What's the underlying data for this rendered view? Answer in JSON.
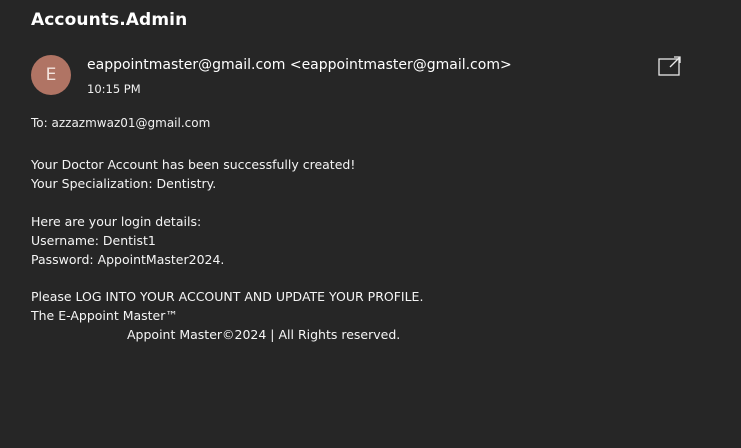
{
  "email": {
    "subject": "Accounts.Admin",
    "avatar_initial": "E",
    "sender": "eappointmaster@gmail.com <eappointmaster@gmail.com>",
    "time": "10:15 PM",
    "to": "To: azzazmwaz01@gmail.com",
    "popout_icon": "open-in-new-window-icon",
    "body": {
      "line1": "Your Doctor Account has been successfully created!",
      "line2": "Your Specialization: Dentistry.",
      "line3": "Here are your login details:",
      "line4": "Username: Dentist1",
      "line5": "Password: AppointMaster2024.",
      "line6": "Please LOG INTO YOUR ACCOUNT AND UPDATE YOUR PROFILE.",
      "line7": "The E-Appoint Master™",
      "footer": "Appoint Master©2024 | All Rights reserved."
    }
  },
  "colors": {
    "background": "#262626",
    "avatar": "#b07464",
    "text": "#ffffff"
  }
}
